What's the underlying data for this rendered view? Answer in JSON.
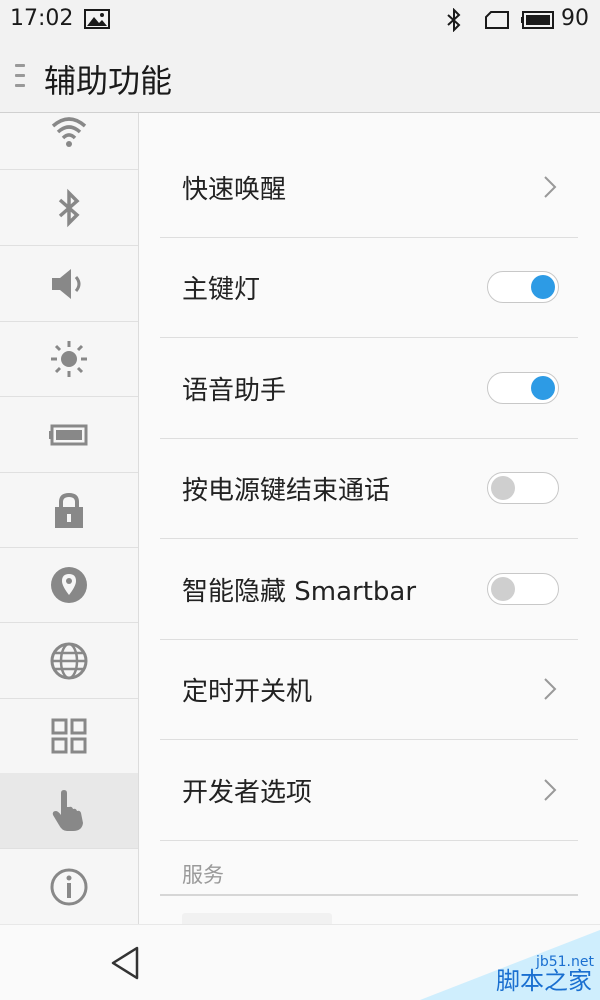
{
  "status_bar": {
    "time": "17:02",
    "battery": "90"
  },
  "app_bar": {
    "title": "辅助功能"
  },
  "sidebar": {
    "items": [
      {
        "icon": "wifi-icon"
      },
      {
        "icon": "bluetooth-icon"
      },
      {
        "icon": "volume-icon"
      },
      {
        "icon": "brightness-icon"
      },
      {
        "icon": "battery-icon"
      },
      {
        "icon": "lock-icon"
      },
      {
        "icon": "location-icon"
      },
      {
        "icon": "globe-icon"
      },
      {
        "icon": "apps-grid-icon"
      },
      {
        "icon": "hand-pointer-icon",
        "active": true
      },
      {
        "icon": "info-icon"
      }
    ]
  },
  "settings": {
    "rows": [
      {
        "label": "快速唤醒",
        "control": "chevron"
      },
      {
        "label": "主键灯",
        "control": "toggle",
        "on": true
      },
      {
        "label": "语音助手",
        "control": "toggle",
        "on": true
      },
      {
        "label": "按电源键结束通话",
        "control": "toggle",
        "on": false
      },
      {
        "label": "智能隐藏 Smartbar",
        "control": "toggle",
        "on": false
      },
      {
        "label": "定时开关机",
        "control": "chevron"
      },
      {
        "label": "开发者选项",
        "control": "chevron"
      }
    ],
    "section": "服务"
  },
  "watermark": {
    "url": "jb51.net",
    "text": "脚本之家"
  },
  "colors": {
    "accent": "#2d9be5",
    "icon_gray": "#888888"
  }
}
